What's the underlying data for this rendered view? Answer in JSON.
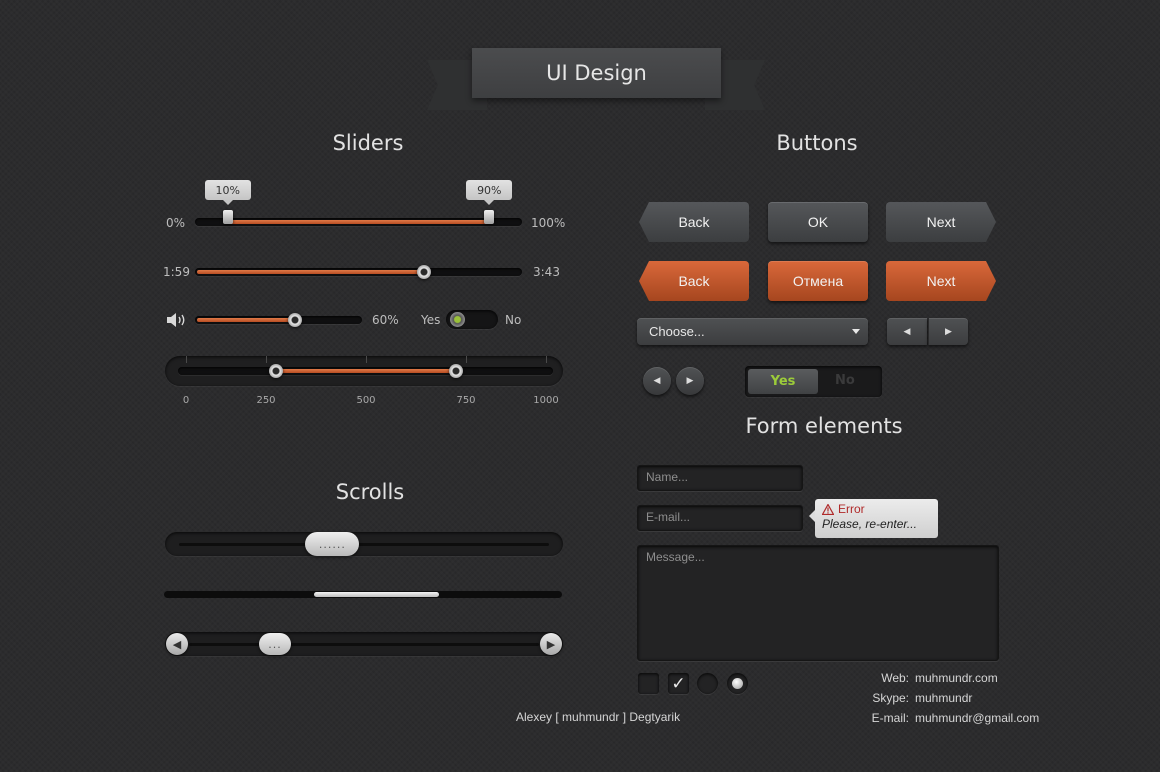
{
  "header": {
    "title": "UI Design"
  },
  "sections": {
    "sliders": "Sliders",
    "buttons": "Buttons",
    "form": "Form elements",
    "scrolls": "Scrolls"
  },
  "sliders": {
    "range": {
      "min_label": "0%",
      "max_label": "100%",
      "low_tip": "10%",
      "high_tip": "90%",
      "low": 0.1,
      "high": 0.9
    },
    "media": {
      "start_label": "1:59",
      "end_label": "3:43",
      "progress": 0.7
    },
    "volume": {
      "icon": "speaker-icon",
      "value_label": "60%",
      "value": 0.6
    },
    "toggle": {
      "yes_label": "Yes",
      "no_label": "No",
      "state": "yes"
    },
    "scale": {
      "labels": [
        "0",
        "250",
        "500",
        "750",
        "1000"
      ],
      "low": 250,
      "high": 750
    }
  },
  "scrolls": {
    "first": {
      "grip": "......",
      "position": 0.4
    },
    "second": {
      "position": 0.55
    },
    "third": {
      "grip": "...",
      "position": 0.22
    }
  },
  "buttons": {
    "gray": {
      "back": "Back",
      "ok": "OK",
      "next": "Next"
    },
    "orange": {
      "back": "Back",
      "cancel": "Отмена",
      "next": "Next"
    },
    "select_value": "Choose...",
    "toggle": {
      "yes": "Yes",
      "no": "No",
      "state": "yes"
    }
  },
  "form": {
    "name_placeholder": "Name...",
    "email_placeholder": "E-mail...",
    "message_placeholder": "Message...",
    "error_title": "Error",
    "error_message": "Please, re-enter...",
    "checkbox_checked": true
  },
  "footer": {
    "author": "Alexey  [ muhmundr ] Degtyarik",
    "web_label": "Web:",
    "web": "muhmundr.com",
    "skype_label": "Skype:",
    "skype": "muhmundr",
    "email_label": "E-mail:",
    "email": "muhmundr@gmail.com"
  }
}
